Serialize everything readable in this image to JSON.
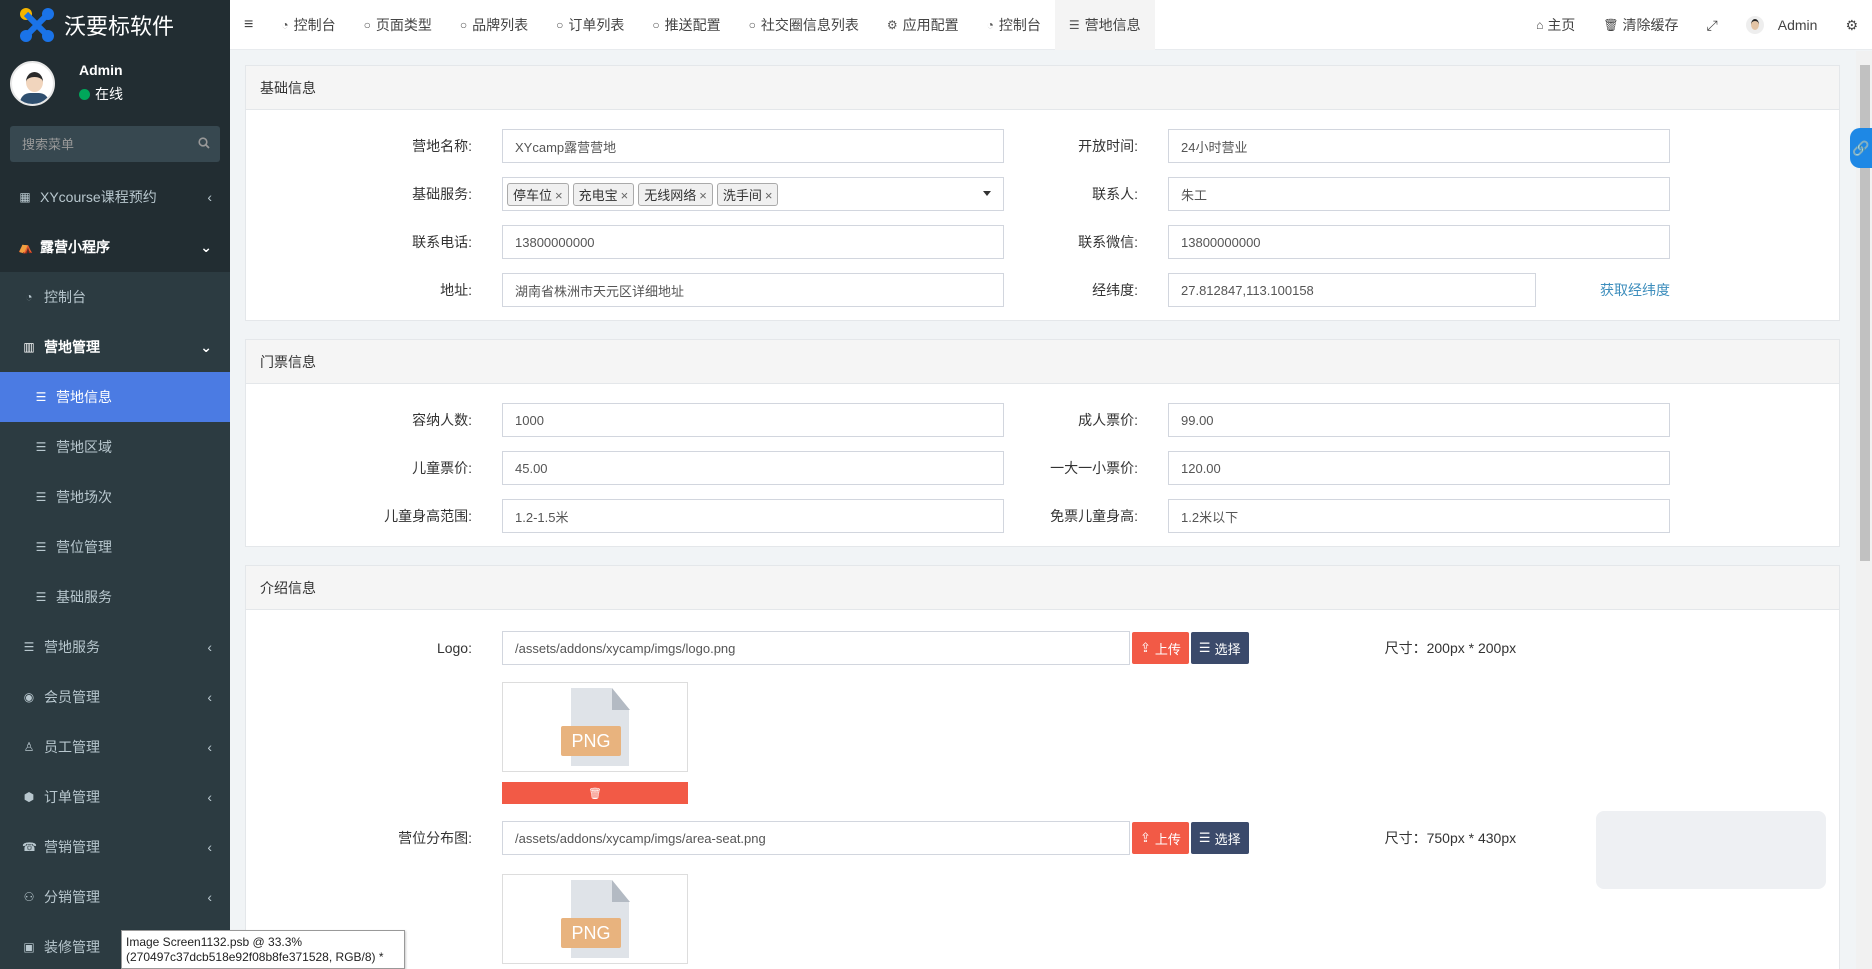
{
  "app": {
    "title": "沃要标软件"
  },
  "user": {
    "name": "Admin",
    "status": "在线"
  },
  "search": {
    "placeholder": "搜索菜单"
  },
  "sidebar": {
    "items": [
      {
        "label": "XYcourse课程预约",
        "icon": "grid-icon"
      },
      {
        "label": "露营小程序",
        "icon": "camp-icon"
      },
      {
        "label": "控制台",
        "icon": "dashboard-icon"
      },
      {
        "label": "营地管理",
        "icon": "map-icon"
      },
      {
        "label": "营地信息",
        "icon": "list-icon"
      },
      {
        "label": "营地区域",
        "icon": "list-icon"
      },
      {
        "label": "营地场次",
        "icon": "list-icon"
      },
      {
        "label": "营位管理",
        "icon": "list-icon"
      },
      {
        "label": "基础服务",
        "icon": "list-icon"
      },
      {
        "label": "营地服务",
        "icon": "list-icon"
      },
      {
        "label": "会员管理",
        "icon": "user-circle-icon"
      },
      {
        "label": "员工管理",
        "icon": "user-icon"
      },
      {
        "label": "订单管理",
        "icon": "cube-icon"
      },
      {
        "label": "营销管理",
        "icon": "megaphone-icon"
      },
      {
        "label": "分销管理",
        "icon": "sitemap-icon"
      },
      {
        "label": "装修管理",
        "icon": "paint-icon"
      }
    ]
  },
  "tabs": [
    {
      "label": "控制台"
    },
    {
      "label": "页面类型"
    },
    {
      "label": "品牌列表"
    },
    {
      "label": "订单列表"
    },
    {
      "label": "推送配置"
    },
    {
      "label": "社交圈信息列表"
    },
    {
      "label": "应用配置"
    },
    {
      "label": "控制台"
    },
    {
      "label": "营地信息"
    }
  ],
  "topright": {
    "home": "主页",
    "clear": "清除缓存",
    "user": "Admin"
  },
  "basic": {
    "heading": "基础信息",
    "name_label": "营地名称:",
    "name_value": "XYcamp露营营地",
    "open_label": "开放时间:",
    "open_value": "24小时营业",
    "service_label": "基础服务:",
    "services": [
      "停车位",
      "充电宝",
      "无线网络",
      "洗手间"
    ],
    "contact_label": "联系人:",
    "contact_value": "朱工",
    "phone_label": "联系电话:",
    "phone_value": "13800000000",
    "wechat_label": "联系微信:",
    "wechat_value": "13800000000",
    "address_label": "地址:",
    "address_value": "湖南省株洲市天元区详细地址",
    "latlng_label": "经纬度:",
    "latlng_value": "27.812847,113.100158",
    "latlng_link": "获取经纬度"
  },
  "ticket": {
    "heading": "门票信息",
    "capacity_label": "容纳人数:",
    "capacity_value": "1000",
    "adult_label": "成人票价:",
    "adult_value": "99.00",
    "child_label": "儿童票价:",
    "child_value": "45.00",
    "family_label": "一大一小票价:",
    "family_value": "120.00",
    "height_label": "儿童身高范围:",
    "height_value": "1.2-1.5米",
    "free_label": "免票儿童身高:",
    "free_value": "1.2米以下"
  },
  "intro": {
    "heading": "介绍信息",
    "logo_label": "Logo:",
    "logo_value": "/assets/addons/xycamp/imgs/logo.png",
    "logo_size": "尺寸：200px * 200px",
    "seat_label": "营位分布图:",
    "seat_value": "/assets/addons/xycamp/imgs/area-seat.png",
    "seat_size": "尺寸：750px * 430px",
    "upload": "上传",
    "select": "选择",
    "png": "PNG"
  },
  "tooltip": {
    "line1": "Image Screen1132.psb @ 33.3%",
    "line2": "(270497c37dcb518e92f08b8fe371528, RGB/8) *"
  }
}
